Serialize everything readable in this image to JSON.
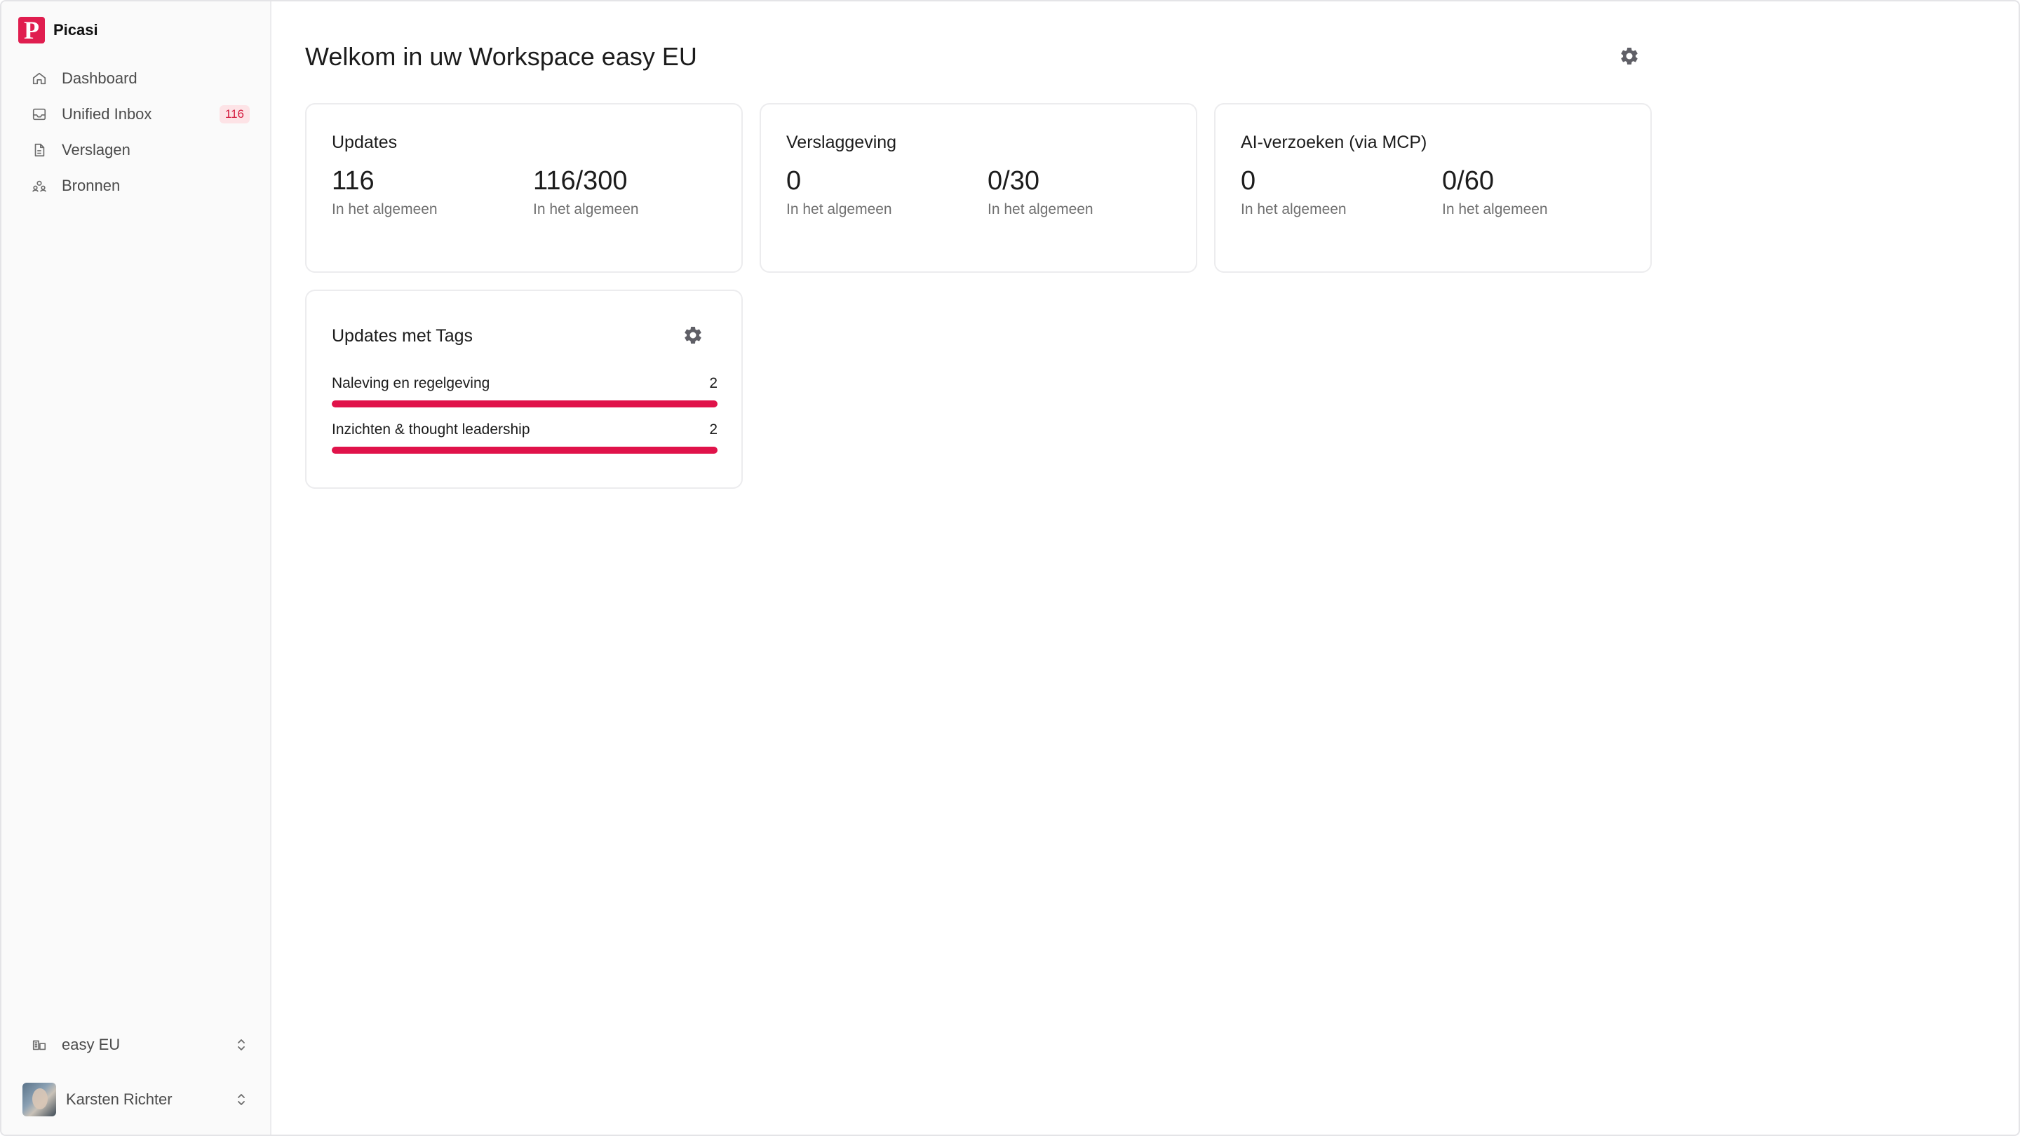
{
  "app": {
    "name": "Picasi",
    "logo_letter": "P",
    "accent": "#e0134a"
  },
  "sidebar": {
    "items": [
      {
        "label": "Dashboard",
        "icon": "home-icon"
      },
      {
        "label": "Unified Inbox",
        "icon": "inbox-icon",
        "badge": "116"
      },
      {
        "label": "Verslagen",
        "icon": "document-icon"
      },
      {
        "label": "Bronnen",
        "icon": "sources-icon"
      }
    ],
    "workspace": {
      "label": "easy EU",
      "icon": "workspace-icon"
    },
    "user": {
      "name": "Karsten Richter"
    }
  },
  "main": {
    "title": "Welkom in uw Workspace easy EU",
    "cards": [
      {
        "title": "Updates",
        "stats": [
          {
            "value": "116",
            "label": "In het algemeen"
          },
          {
            "value": "116/300",
            "label": "In het algemeen"
          }
        ]
      },
      {
        "title": "Verslaggeving",
        "stats": [
          {
            "value": "0",
            "label": "In het algemeen"
          },
          {
            "value": "0/30",
            "label": "In het algemeen"
          }
        ]
      },
      {
        "title": "AI-verzoeken (via MCP)",
        "stats": [
          {
            "value": "0",
            "label": "In het algemeen"
          },
          {
            "value": "0/60",
            "label": "In het algemeen"
          }
        ]
      }
    ],
    "tags_card": {
      "title": "Updates met Tags",
      "tags": [
        {
          "label": "Naleving en regelgeving",
          "count": "2",
          "fill": 1.0
        },
        {
          "label": "Inzichten & thought leadership",
          "count": "2",
          "fill": 1.0
        }
      ]
    }
  }
}
